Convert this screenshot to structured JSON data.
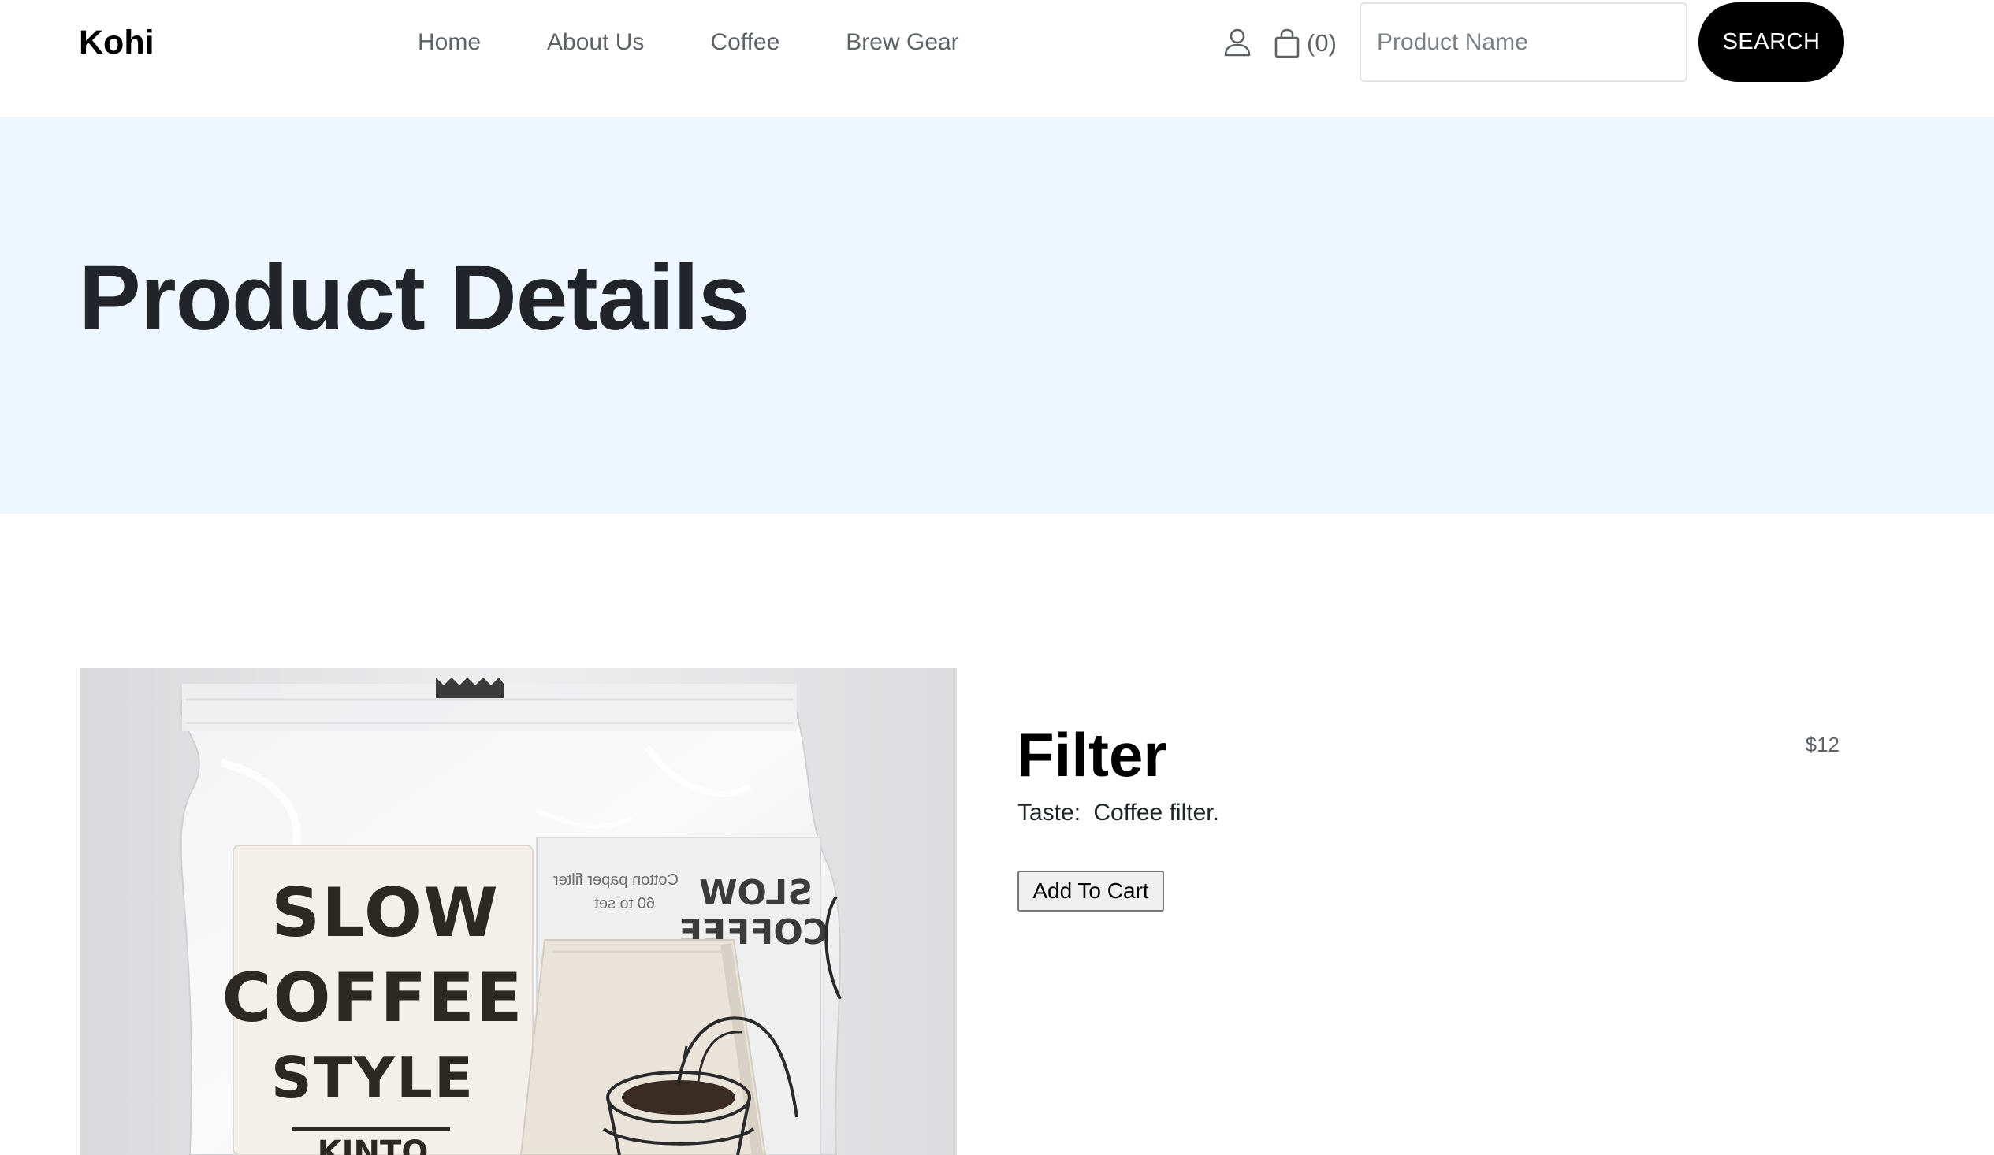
{
  "header": {
    "brand": "Kohi",
    "nav": [
      "Home",
      "About Us",
      "Coffee",
      "Brew Gear"
    ],
    "cart_count": "(0)",
    "search_placeholder": "Product Name",
    "search_button": "SEARCH",
    "icons": [
      "user-icon",
      "shopping-bag-icon"
    ]
  },
  "banner": {
    "title": "Product Details",
    "background": "#eef6ff"
  },
  "product": {
    "name": "Filter",
    "price": "$12",
    "description_label": "Taste:",
    "description_value": "Coffee filter.",
    "add_to_cart": "Add To Cart",
    "image": {
      "bag_text_front": [
        "SLOW",
        "COFFEE",
        "STYLE",
        "KINTO"
      ],
      "bag_text_back": [
        "Cotton paper filter",
        "60 to set"
      ],
      "bag_text_side": [
        "SLOW",
        "COFFEE"
      ]
    }
  },
  "colors": {
    "accent_button": "#000000",
    "banner_bg": "#eef6ff",
    "text_dark": "#212529",
    "text_muted": "#5f6368"
  }
}
